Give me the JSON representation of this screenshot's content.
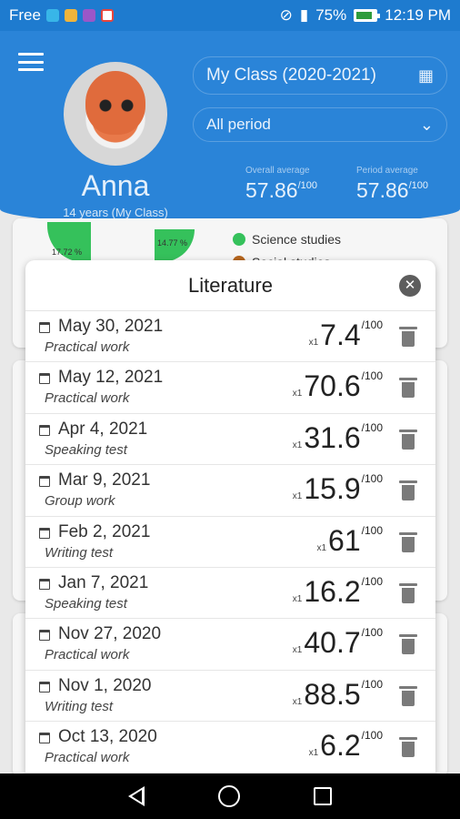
{
  "status_bar": {
    "carrier": "Free",
    "battery": "75%",
    "time": "12:19 PM"
  },
  "header": {
    "student_name": "Anna",
    "student_info": "14 years (My Class)",
    "class_select": "My Class (2020-2021)",
    "period_select": "All period",
    "overall_label": "Overall average",
    "overall_value": "57.86",
    "overall_max": "/100",
    "period_label": "Period average",
    "period_value": "57.86",
    "period_max": "/100"
  },
  "background": {
    "pie_label_1": "17.72 %",
    "pie_label_2": "14.77 %",
    "legend_1": "Science studies",
    "legend_2": "Social studies",
    "legend_1_color": "#35c15b",
    "legend_2_color": "#b5651d"
  },
  "modal": {
    "title": "Literature",
    "grades": [
      {
        "date": "May 30, 2021",
        "type": "Practical work",
        "coef": "x1",
        "value": "7.4",
        "max": "/100"
      },
      {
        "date": "May 12, 2021",
        "type": "Practical work",
        "coef": "x1",
        "value": "70.6",
        "max": "/100"
      },
      {
        "date": "Apr 4, 2021",
        "type": "Speaking test",
        "coef": "x1",
        "value": "31.6",
        "max": "/100"
      },
      {
        "date": "Mar 9, 2021",
        "type": "Group work",
        "coef": "x1",
        "value": "15.9",
        "max": "/100"
      },
      {
        "date": "Feb 2, 2021",
        "type": "Writing test",
        "coef": "x1",
        "value": "61",
        "max": "/100"
      },
      {
        "date": "Jan 7, 2021",
        "type": "Speaking test",
        "coef": "x1",
        "value": "16.2",
        "max": "/100"
      },
      {
        "date": "Nov 27, 2020",
        "type": "Practical work",
        "coef": "x1",
        "value": "40.7",
        "max": "/100"
      },
      {
        "date": "Nov 1, 2020",
        "type": "Writing test",
        "coef": "x1",
        "value": "88.5",
        "max": "/100"
      },
      {
        "date": "Oct 13, 2020",
        "type": "Practical work",
        "coef": "x1",
        "value": "6.2",
        "max": "/100"
      }
    ]
  },
  "colors": {
    "header_blue": "#2a84d8",
    "status_blue": "#1e7bcf"
  }
}
